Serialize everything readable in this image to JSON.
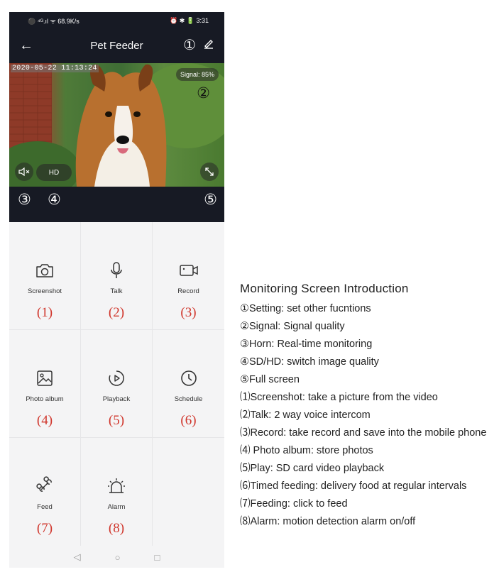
{
  "status": {
    "left": "⚫ ⁴ᴳ.ıl ᯤ 68.9K/s",
    "right": "⏰ ✱ 🔋 3:31"
  },
  "appbar": {
    "title": "Pet Feeder",
    "settings_callout": "①"
  },
  "video": {
    "timestamp": "2020-05-22 11:13:24",
    "signal": "Signal: 85%",
    "signal_callout": "②",
    "hd_label": "HD"
  },
  "strip": {
    "callout3": "③",
    "callout4": "④",
    "callout5": "⑤"
  },
  "grid": {
    "items": [
      {
        "label": "Screenshot",
        "num": "(1)",
        "icon": "camera-icon"
      },
      {
        "label": "Talk",
        "num": "(2)",
        "icon": "microphone-icon"
      },
      {
        "label": "Record",
        "num": "(3)",
        "icon": "video-camera-icon"
      },
      {
        "label": "Photo album",
        "num": "(4)",
        "icon": "image-icon"
      },
      {
        "label": "Playback",
        "num": "(5)",
        "icon": "playback-icon"
      },
      {
        "label": "Schedule",
        "num": "(6)",
        "icon": "clock-icon"
      },
      {
        "label": "Feed",
        "num": "(7)",
        "icon": "bone-icon"
      },
      {
        "label": "Alarm",
        "num": "(8)",
        "icon": "alarm-icon"
      }
    ]
  },
  "intro": {
    "title": "Monitoring Screen Introduction",
    "lines": [
      "①Setting: set other fucntions",
      "②Signal: Signal quality",
      "③Horn: Real-time monitoring",
      "④SD/HD: switch image quality",
      "⑤Full screen",
      "⑴Screenshot:   take a picture from the video",
      "⑵Talk:  2 way voice intercom",
      "⑶Record:  take record and save into the mobile phone",
      "⑷ Photo album: store photos",
      "⑸Play:  SD card video playback",
      "⑹Timed feeding:   delivery food at regular intervals",
      "⑺Feeding:   click to feed",
      "⑻Alarm:   motion detection alarm on/off"
    ]
  },
  "colors": {
    "dark": "#171a24",
    "accent_red": "#d0352b",
    "grid_bg": "#f4f4f5"
  }
}
